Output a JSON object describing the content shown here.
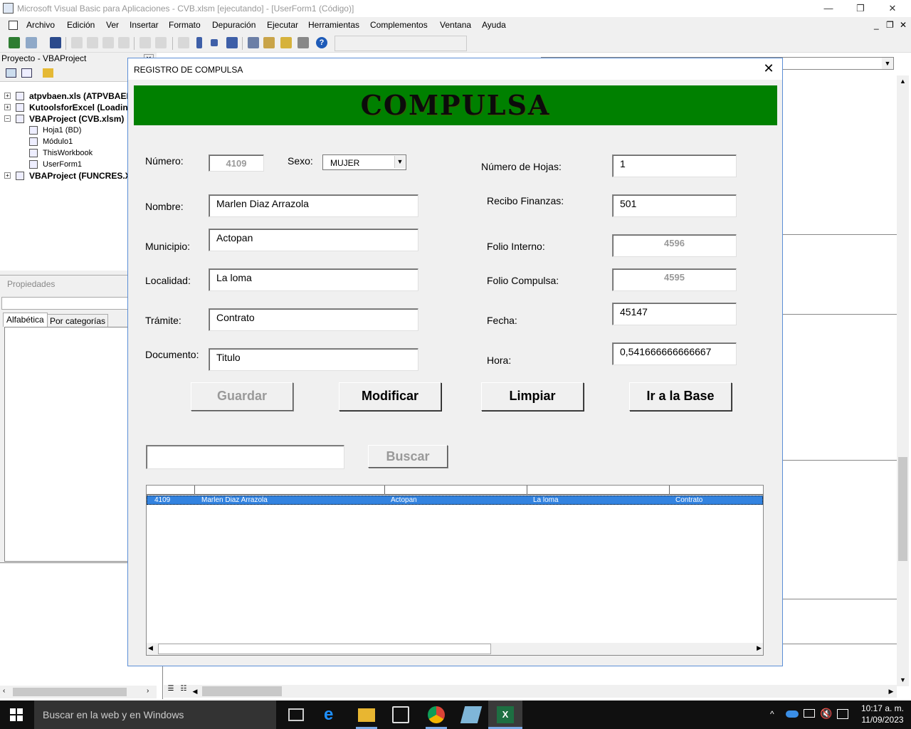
{
  "window": {
    "title": "Microsoft Visual Basic para Aplicaciones - CVB.xlsm [ejecutando] - [UserForm1 (Código)]",
    "minimize": "—",
    "restore": "❐",
    "close": "✕"
  },
  "menu": {
    "items": [
      "Archivo",
      "Edición",
      "Ver",
      "Insertar",
      "Formato",
      "Depuración",
      "Ejecutar",
      "Herramientas",
      "Complementos",
      "Ventana",
      "Ayuda"
    ]
  },
  "project": {
    "header": "Proyecto - VBAProject",
    "items": [
      "atpvbaen.xls (ATPVBAEN",
      "KutoolsforExcel (Loading",
      "VBAProject (CVB.xlsm)",
      "Hoja1 (BD)",
      "Módulo1",
      "ThisWorkbook",
      "UserForm1",
      "VBAProject (FUNCRES.XL"
    ]
  },
  "properties": {
    "header": "Propiedades",
    "tab_alpha": "Alfabética",
    "tab_cat": "Por categorías"
  },
  "form": {
    "title": "REGISTRO DE COMPULSA",
    "close": "✕",
    "banner": "COMPULSA",
    "labels": {
      "numero": "Número:",
      "sexo": "Sexo:",
      "nombre": "Nombre:",
      "municipio": "Municipio:",
      "localidad": "Localidad:",
      "tramite": "Trámite:",
      "documento": "Documento:",
      "num_hojas": "Número de Hojas:",
      "recibo": "Recibo Finanzas:",
      "folio_interno": "Folio Interno:",
      "folio_compulsa": "Folio Compulsa:",
      "fecha": "Fecha:",
      "hora": "Hora:"
    },
    "values": {
      "numero": "4109",
      "sexo": "MUJER",
      "nombre": "Marlen Diaz Arrazola",
      "municipio": "Actopan",
      "localidad": "La loma",
      "tramite": "Contrato",
      "documento": "Titulo",
      "num_hojas": "1",
      "recibo": "501",
      "folio_interno": "4596",
      "folio_compulsa": "4595",
      "fecha": "45147",
      "hora": "0,541666666666667",
      "search": ""
    },
    "buttons": {
      "guardar": "Guardar",
      "modificar": "Modificar",
      "limpiar": "Limpiar",
      "ir_base": "Ir a la Base",
      "buscar": "Buscar"
    },
    "list_row": [
      "4109",
      "Marlen Diaz Arrazola",
      "Actopan",
      "La loma",
      "Contrato"
    ]
  },
  "taskbar": {
    "search": "Buscar en la web y en Windows",
    "time": "10:17 a. m.",
    "date": "11/09/2023"
  }
}
